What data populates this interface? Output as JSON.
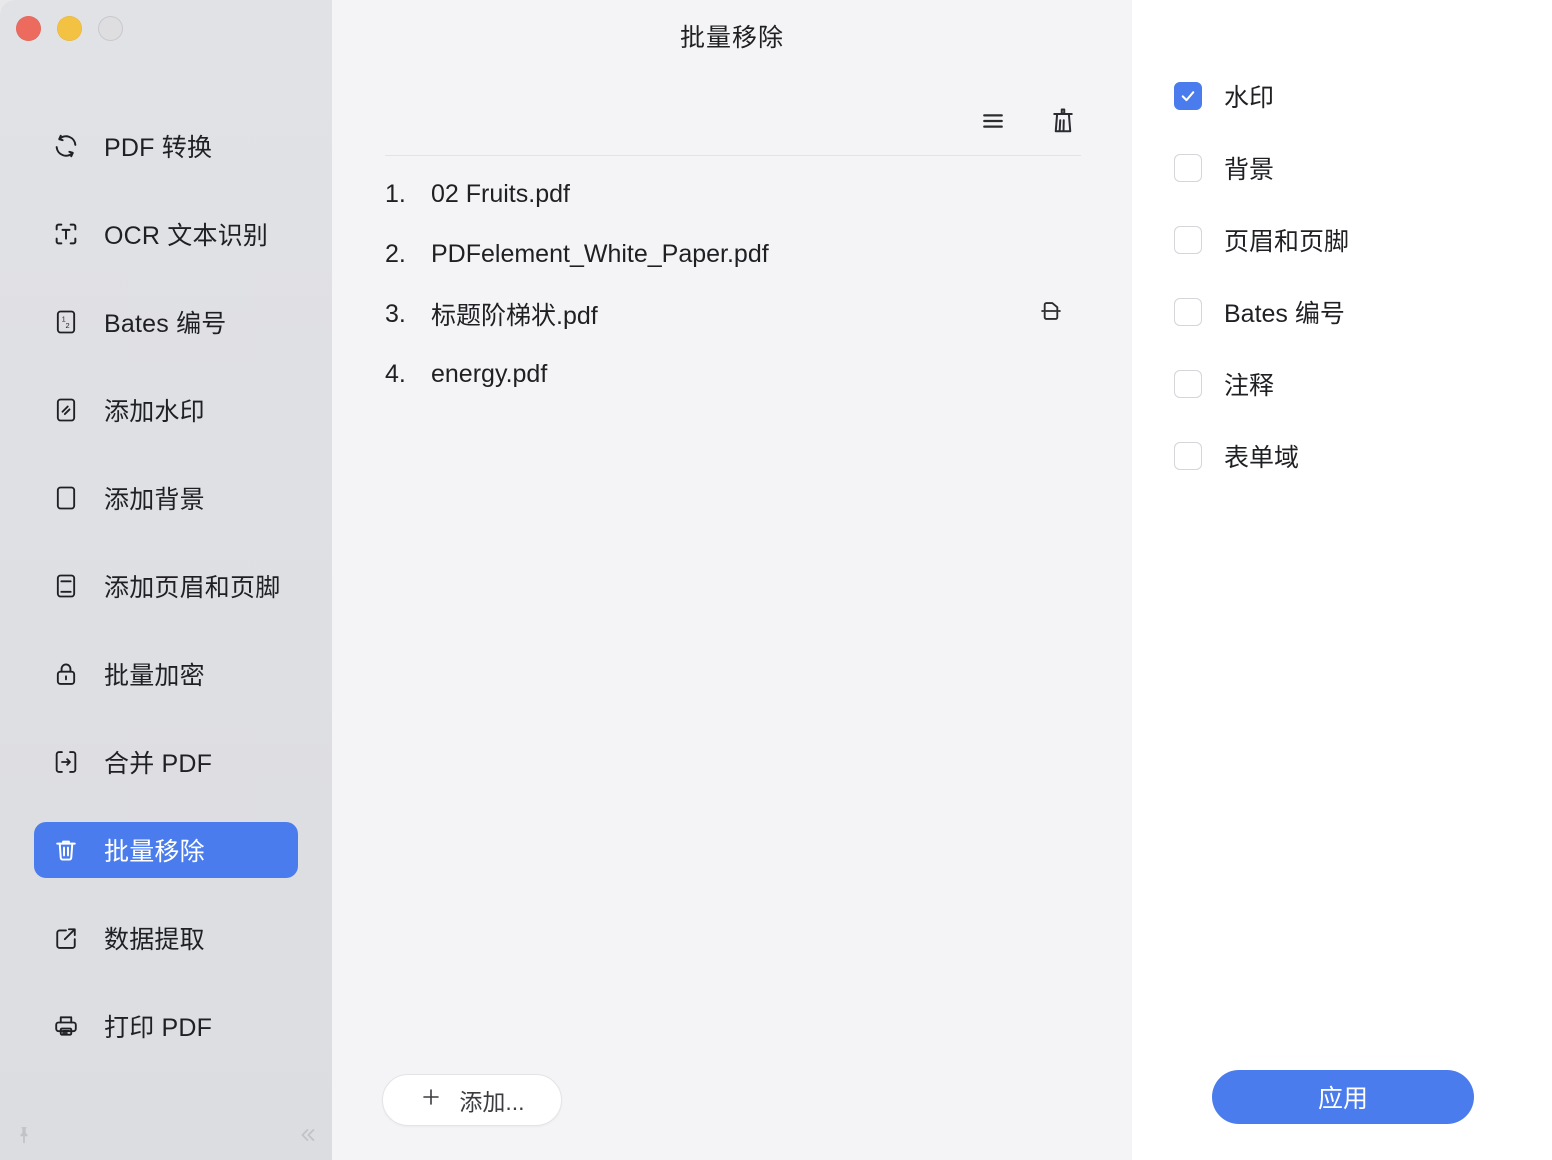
{
  "window": {
    "traffic_lights": [
      "close",
      "minimize",
      "zoom"
    ]
  },
  "sidebar": {
    "items": [
      {
        "icon": "refresh-convert-icon",
        "label": "PDF 转换",
        "active": false
      },
      {
        "icon": "ocr-text-icon",
        "label": "OCR 文本识别",
        "active": false
      },
      {
        "icon": "bates-number-icon",
        "label": "Bates 编号",
        "active": false
      },
      {
        "icon": "watermark-icon",
        "label": "添加水印",
        "active": false
      },
      {
        "icon": "background-icon",
        "label": "添加背景",
        "active": false
      },
      {
        "icon": "header-footer-icon",
        "label": "添加页眉和页脚",
        "active": false
      },
      {
        "icon": "lock-icon",
        "label": "批量加密",
        "active": false
      },
      {
        "icon": "merge-pdf-icon",
        "label": "合并 PDF",
        "active": false
      },
      {
        "icon": "trash-icon",
        "label": "批量移除",
        "active": true
      },
      {
        "icon": "data-extract-icon",
        "label": "数据提取",
        "active": false
      },
      {
        "icon": "printer-icon",
        "label": "打印 PDF",
        "active": false
      }
    ],
    "footer": {
      "pin_icon": "pin-icon",
      "collapse_icon": "chevron-double-left-icon"
    }
  },
  "main": {
    "title": "批量移除",
    "toolbar": {
      "list_icon": "list-lines-icon",
      "clear_icon": "broom-clear-icon"
    },
    "files": [
      {
        "index": "1.",
        "name": "02 Fruits.pdf",
        "action_icon": ""
      },
      {
        "index": "2.",
        "name": "PDFelement_White_Paper.pdf",
        "action_icon": ""
      },
      {
        "index": "3.",
        "name": "标题阶梯状.pdf",
        "action_icon": "split-page-icon"
      },
      {
        "index": "4.",
        "name": "energy.pdf",
        "action_icon": ""
      }
    ],
    "add_button": {
      "icon": "plus-icon",
      "label": "添加..."
    }
  },
  "right_panel": {
    "options": [
      {
        "label": "水印",
        "checked": true
      },
      {
        "label": "背景",
        "checked": false
      },
      {
        "label": "页眉和页脚",
        "checked": false
      },
      {
        "label": "Bates 编号",
        "checked": false
      },
      {
        "label": "注释",
        "checked": false
      },
      {
        "label": "表单域",
        "checked": false
      }
    ],
    "apply_label": "应用"
  },
  "colors": {
    "accent": "#4a7ced",
    "sidebar_bg": "#dfe0e4",
    "main_bg": "#f4f4f6",
    "panel_bg": "#ffffff",
    "text": "#1f2023",
    "traffic_red": "#ed6a5e",
    "traffic_yellow": "#f3c242",
    "traffic_gray": "#dedee1"
  }
}
